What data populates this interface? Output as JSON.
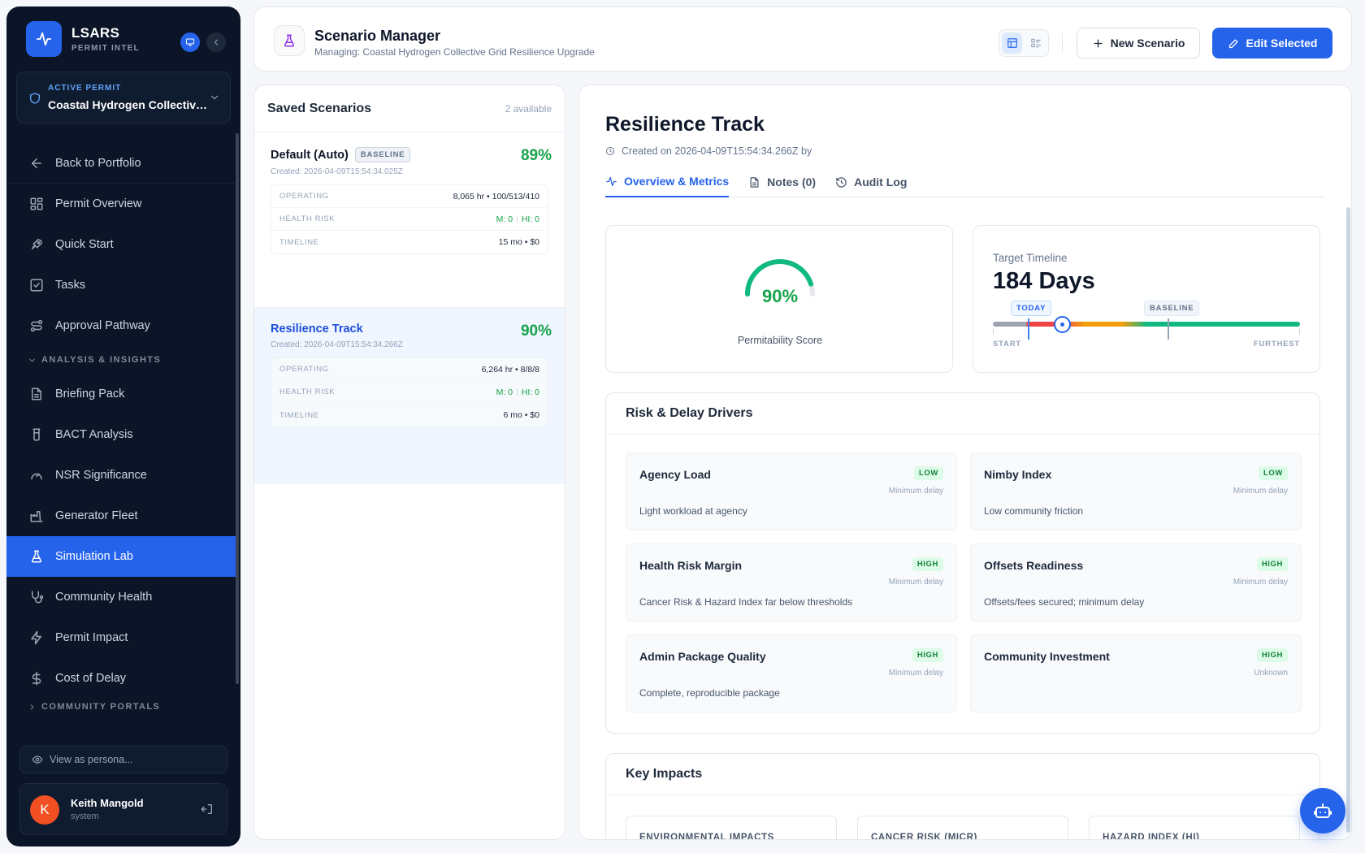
{
  "sidebar": {
    "brand": {
      "name": "LSARS",
      "subtitle": "PERMIT INTEL"
    },
    "permit": {
      "label": "ACTIVE PERMIT",
      "name": "Coastal Hydrogen Collective Grid Resilience Upgrade"
    },
    "nav": [
      {
        "label": "Back to Portfolio",
        "icon": "arrow-left-icon"
      },
      {
        "label": "Permit Overview",
        "icon": "grid-icon"
      },
      {
        "label": "Quick Start",
        "icon": "rocket-icon"
      },
      {
        "label": "Tasks",
        "icon": "checkbox-icon"
      },
      {
        "label": "Approval Pathway",
        "icon": "route-icon"
      },
      {
        "label": "Briefing Pack",
        "icon": "document-icon"
      },
      {
        "label": "BACT Analysis",
        "icon": "beaker-icon"
      },
      {
        "label": "NSR Significance",
        "icon": "gauge-icon"
      },
      {
        "label": "Generator Fleet",
        "icon": "factory-icon"
      },
      {
        "label": "Simulation Lab",
        "icon": "flask-icon"
      },
      {
        "label": "Community Health",
        "icon": "stethoscope-icon"
      },
      {
        "label": "Permit Impact",
        "icon": "lightning-icon"
      },
      {
        "label": "Cost of Delay",
        "icon": "dollar-icon"
      }
    ],
    "sections": {
      "analysis": "ANALYSIS & INSIGHTS",
      "community": "COMMUNITY PORTALS"
    },
    "persona_placeholder": "View as persona...",
    "user": {
      "initial": "K",
      "name": "Keith Mangold",
      "role": "system"
    },
    "accent": "#2563eb"
  },
  "topbar": {
    "title": "Scenario Manager",
    "subtitle": "Managing: Coastal Hydrogen Collective Grid Resilience Upgrade",
    "new_label": "New Scenario",
    "edit_label": "Edit Selected"
  },
  "scenarios": {
    "title": "Saved Scenarios",
    "count": "2 available",
    "items": [
      {
        "name": "Default (Auto)",
        "badge": "BASELINE",
        "score": "89%",
        "created": "Created: 2026-04-09T15:54:34.025Z",
        "operating": "8,065 hr • 100/513/410",
        "health_m": "M: 0",
        "health_hi": "HI: 0",
        "timeline": "15 mo • $0"
      },
      {
        "name": "Resilience Track",
        "score": "90%",
        "created": "Created: 2026-04-09T15:54:34.266Z",
        "operating": "6,264 hr • 8/8/8",
        "health_m": "M: 0",
        "health_hi": "HI: 0",
        "timeline": "6 mo • $0"
      }
    ],
    "labels": {
      "operating": "OPERATING",
      "health": "HEALTH RISK",
      "timeline": "TIMELINE"
    }
  },
  "detail": {
    "title": "Resilience Track",
    "created": "Created on 2026-04-09T15:54:34.266Z by",
    "tabs": [
      {
        "label": "Overview & Metrics",
        "icon": "activity-icon"
      },
      {
        "label": "Notes (0)",
        "icon": "notes-icon"
      },
      {
        "label": "Audit Log",
        "icon": "history-icon"
      }
    ],
    "score": {
      "value": "90%",
      "fraction": 0.9,
      "label": "Permitability Score",
      "color": "#10b981"
    },
    "timeline": {
      "label": "Target Timeline",
      "value": "184 Days",
      "today_tag": "TODAY",
      "baseline_tag": "BASELINE",
      "start": "START",
      "end": "FURTHEST"
    },
    "risk": {
      "title": "Risk & Delay Drivers",
      "items": [
        {
          "name": "Agency Load",
          "level": "LOW",
          "delay": "Minimum delay",
          "desc": "Light workload at agency"
        },
        {
          "name": "Nimby Index",
          "level": "LOW",
          "delay": "Minimum delay",
          "desc": "Low community friction"
        },
        {
          "name": "Health Risk Margin",
          "level": "HIGH",
          "delay": "Minimum delay",
          "desc": "Cancer Risk & Hazard Index far below thresholds"
        },
        {
          "name": "Offsets Readiness",
          "level": "HIGH",
          "delay": "Minimum delay",
          "desc": "Offsets/fees secured; minimum delay"
        },
        {
          "name": "Admin Package Quality",
          "level": "HIGH",
          "delay": "Minimum delay",
          "desc": "Complete, reproducible package"
        },
        {
          "name": "Community Investment",
          "level": "HIGH",
          "delay": "Unknown",
          "desc": ""
        }
      ]
    },
    "impacts": {
      "title": "Key Impacts",
      "items": [
        "ENVIRONMENTAL IMPACTS",
        "CANCER RISK (MICR)",
        "HAZARD INDEX (HI)"
      ]
    }
  }
}
